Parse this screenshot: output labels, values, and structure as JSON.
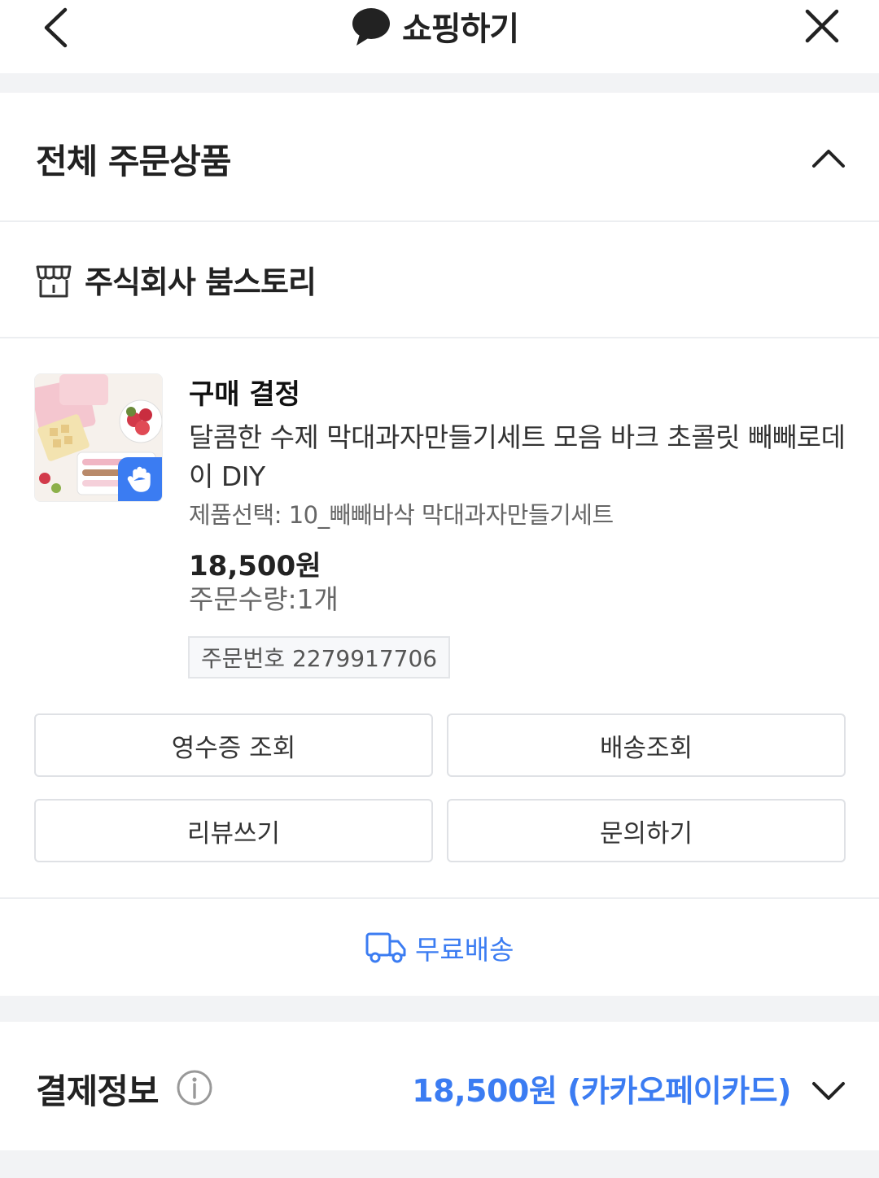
{
  "header": {
    "title": "쇼핑하기",
    "back_icon": "chevron-left-icon",
    "close_icon": "close-icon",
    "title_icon": "speech-bubble-icon"
  },
  "order_section": {
    "title": "전체 주문상품",
    "collapse_icon": "chevron-up-icon"
  },
  "store": {
    "icon": "store-icon",
    "name": "주식회사 붐스토리"
  },
  "product": {
    "status": "구매 결정",
    "name": "달콤한 수제 막대과자만들기세트 모음 바크 초콜릿 빼빼로데이 DIY",
    "option": "제품선택: 10_빼빼바삭 막대과자만들기세트",
    "price": "18,500원",
    "quantity": "주문수량:1개",
    "order_number": "주문번호 2279917706",
    "thumbnail_badge_icon": "hand-wave-icon"
  },
  "actions": {
    "receipt": "영수증 조회",
    "delivery": "배송조회",
    "review": "리뷰쓰기",
    "inquiry": "문의하기"
  },
  "shipping": {
    "icon": "delivery-truck-icon",
    "label": "무료배송"
  },
  "payment": {
    "title": "결제정보",
    "amount": "18,500원 (카카오페이카드)",
    "expand_icon": "chevron-down-icon"
  },
  "colors": {
    "accent": "#3b7cf2",
    "band": "#f2f3f5",
    "border": "#dfe1e5"
  }
}
